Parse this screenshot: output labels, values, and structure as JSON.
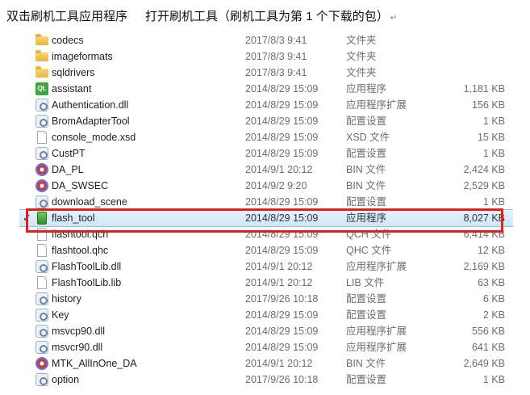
{
  "caption": {
    "step1": "双击刷机工具应用程序",
    "step2": "打开刷机工具（刷机工具为第 1 个下载的包）",
    "return_mark": "↵"
  },
  "files": [
    {
      "name": "codecs",
      "date": "2017/8/3 9:41",
      "type": "文件夹",
      "size": "",
      "icon": "folder-icon"
    },
    {
      "name": "imageformats",
      "date": "2017/8/3 9:41",
      "type": "文件夹",
      "size": "",
      "icon": "folder-icon"
    },
    {
      "name": "sqldrivers",
      "date": "2017/8/3 9:41",
      "type": "文件夹",
      "size": "",
      "icon": "folder-icon"
    },
    {
      "name": "assistant",
      "date": "2014/8/29 15:09",
      "type": "应用程序",
      "size": "1,181 KB",
      "icon": "qt-app-icon"
    },
    {
      "name": "Authentication.dll",
      "date": "2014/8/29 15:09",
      "type": "应用程序扩展",
      "size": "156 KB",
      "icon": "dll-gear-icon"
    },
    {
      "name": "BromAdapterTool",
      "date": "2014/8/29 15:09",
      "type": "配置设置",
      "size": "1 KB",
      "icon": "config-gear-icon"
    },
    {
      "name": "console_mode.xsd",
      "date": "2014/8/29 15:09",
      "type": "XSD 文件",
      "size": "15 KB",
      "icon": "file-icon"
    },
    {
      "name": "CustPT",
      "date": "2014/8/29 15:09",
      "type": "配置设置",
      "size": "1 KB",
      "icon": "config-gear-icon"
    },
    {
      "name": "DA_PL",
      "date": "2014/9/1 20:12",
      "type": "BIN 文件",
      "size": "2,424 KB",
      "icon": "bin-file-icon"
    },
    {
      "name": "DA_SWSEC",
      "date": "2014/9/2 9:20",
      "type": "BIN 文件",
      "size": "2,529 KB",
      "icon": "bin-file-icon"
    },
    {
      "name": "download_scene",
      "date": "2014/8/29 15:09",
      "type": "配置设置",
      "size": "1 KB",
      "icon": "config-gear-icon"
    },
    {
      "name": "flash_tool",
      "date": "2014/8/29 15:09",
      "type": "应用程序",
      "size": "8,027 KB",
      "icon": "app-icon",
      "selected": true
    },
    {
      "name": "flashtool.qch",
      "date": "2014/8/29 15:09",
      "type": "QCH 文件",
      "size": "6,414 KB",
      "icon": "file-icon"
    },
    {
      "name": "flashtool.qhc",
      "date": "2014/8/29 15:09",
      "type": "QHC 文件",
      "size": "12 KB",
      "icon": "file-icon"
    },
    {
      "name": "FlashToolLib.dll",
      "date": "2014/9/1 20:12",
      "type": "应用程序扩展",
      "size": "2,169 KB",
      "icon": "dll-gear-icon"
    },
    {
      "name": "FlashToolLib.lib",
      "date": "2014/9/1 20:12",
      "type": "LIB 文件",
      "size": "63 KB",
      "icon": "file-icon"
    },
    {
      "name": "history",
      "date": "2017/9/26 10:18",
      "type": "配置设置",
      "size": "6 KB",
      "icon": "config-gear-icon"
    },
    {
      "name": "Key",
      "date": "2014/8/29 15:09",
      "type": "配置设置",
      "size": "2 KB",
      "icon": "config-gear-icon"
    },
    {
      "name": "msvcp90.dll",
      "date": "2014/8/29 15:09",
      "type": "应用程序扩展",
      "size": "556 KB",
      "icon": "dll-gear-icon"
    },
    {
      "name": "msvcr90.dll",
      "date": "2014/8/29 15:09",
      "type": "应用程序扩展",
      "size": "641 KB",
      "icon": "dll-gear-icon"
    },
    {
      "name": "MTK_AllInOne_DA",
      "date": "2014/9/1 20:12",
      "type": "BIN 文件",
      "size": "2,649 KB",
      "icon": "bin-file-icon"
    },
    {
      "name": "option",
      "date": "2017/9/26 10:18",
      "type": "配置设置",
      "size": "1 KB",
      "icon": "config-gear-icon"
    }
  ],
  "selection_checkmark": "✓",
  "highlight_color": "#e02020"
}
